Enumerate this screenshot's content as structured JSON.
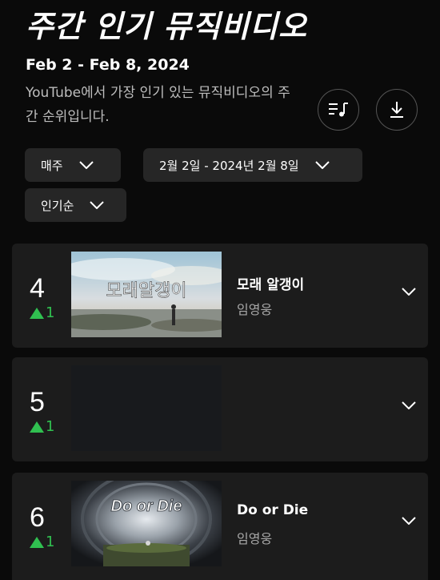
{
  "header": {
    "title": "주간 인기 뮤직비디오",
    "date_range": "Feb 2 - Feb 8, 2024",
    "description": "YouTube에서 가장 인기 있는 뮤직비디오의 주간 순위입니다."
  },
  "actions": {
    "playlist_icon": "playlist-music-icon",
    "download_icon": "download-icon"
  },
  "filters": {
    "period": "매주",
    "dates": "2월 2일 - 2024년 2월 8일",
    "sort": "인기순"
  },
  "chart_rows": [
    {
      "rank": "4",
      "change": "1",
      "title": "모래 알갱이",
      "artist": "임영웅",
      "thumb_text": "모래알갱이"
    },
    {
      "rank": "5",
      "change": "1",
      "title": "",
      "artist": ""
    },
    {
      "rank": "6",
      "change": "1",
      "title": "Do or Die",
      "artist": "임영웅",
      "thumb_text": "Do or Die"
    }
  ],
  "colors": {
    "background": "#0a0a0a",
    "card": "#1c1c1c",
    "chip": "#262626",
    "rank_up": "#30c050"
  }
}
